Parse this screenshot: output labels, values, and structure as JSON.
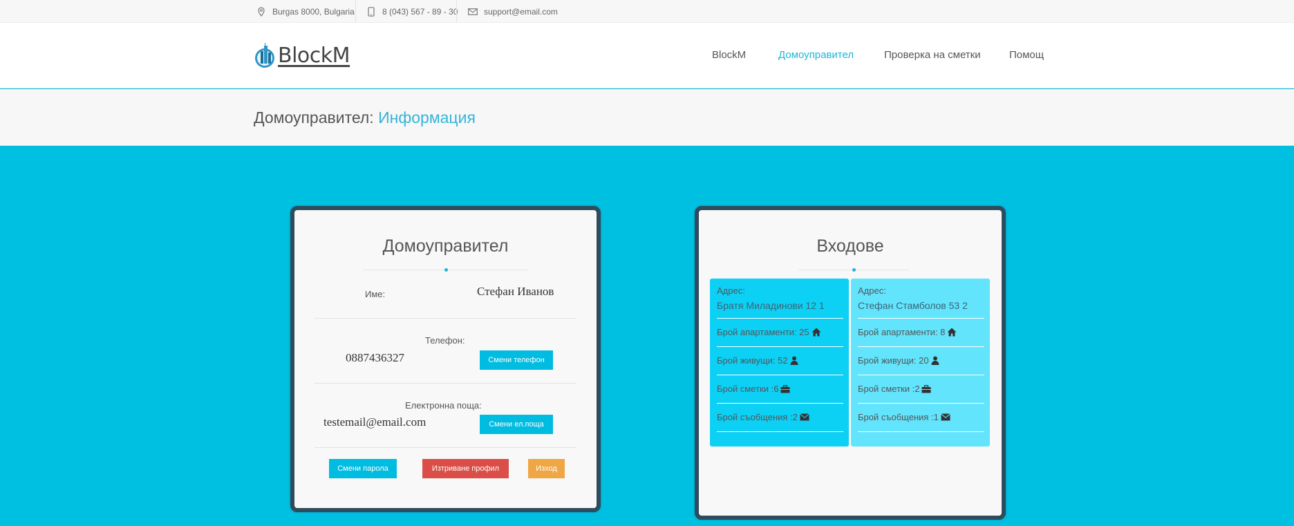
{
  "topbar": {
    "address": "Burgas 8000, Bulgaria",
    "phone": "8 (043) 567 - 89 - 30",
    "email": "support@email.com"
  },
  "header": {
    "logo_text": "BlockM",
    "nav": [
      "BlockM",
      "Домоуправител",
      "Проверка на сметки",
      "Помощ"
    ],
    "active_nav": "Домоуправител"
  },
  "breadcrumb": {
    "section": "Домоуправител:",
    "page": "Информация"
  },
  "manager_card": {
    "title": "Домоуправител",
    "name_label": "Име:",
    "name_value": "Стефан Иванов",
    "phone_label": "Телефон:",
    "phone_value": "0887436327",
    "change_phone": "Смени телефон",
    "email_label": "Електронна поща:",
    "email_value": "testemail@email.com",
    "change_email": "Смени ел.поща",
    "change_password": "Смени парола",
    "delete_profile": "Изтриване профил",
    "logout": "Изход"
  },
  "entrances_card": {
    "title": "Входове",
    "address_label": "Адрес:",
    "entrances": [
      {
        "address": "Братя Миладинови 12 1",
        "apartments": "Брой апартаменти: 25",
        "residents": "Брой живущи: 52",
        "bills": "Брой сметки :6",
        "messages": "Брой съобщения :2",
        "color": "#0dd0f5"
      },
      {
        "address": "Стефан Стамболов 53 2",
        "apartments": "Брой апартаменти: 8",
        "residents": "Брой живущи: 20",
        "bills": "Брой сметки :2",
        "messages": "Брой съобщения :1",
        "color": "#62e4fd"
      }
    ]
  },
  "colors": {
    "background": "#00c0e2",
    "accent": "#1fb5d6",
    "card_border": "#2e4c5d",
    "danger": "#da4e47",
    "warning": "#eea744"
  },
  "icons": [
    "map-marker-icon",
    "phone-icon",
    "envelope-icon",
    "home-icon",
    "user-icon",
    "briefcase-icon"
  ]
}
